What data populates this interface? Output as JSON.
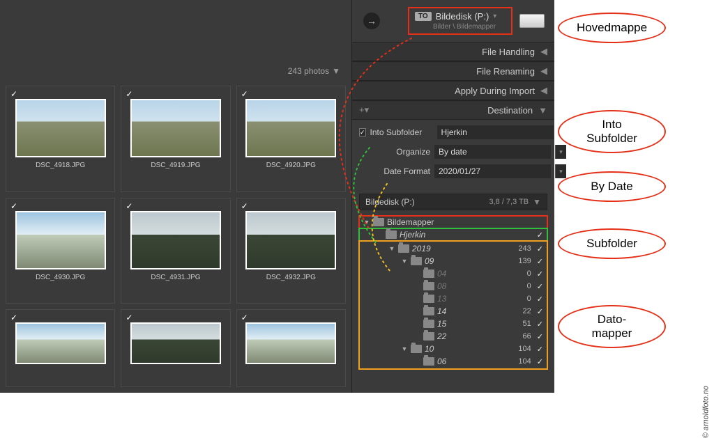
{
  "header": {
    "photo_count": "243 photos"
  },
  "thumbs": [
    {
      "file": "DSC_4918.JPG"
    },
    {
      "file": "DSC_4919.JPG"
    },
    {
      "file": "DSC_4920.JPG"
    },
    {
      "file": "DSC_4930.JPG"
    },
    {
      "file": "DSC_4931.JPG"
    },
    {
      "file": "DSC_4932.JPG"
    },
    {
      "file": ""
    },
    {
      "file": ""
    },
    {
      "file": ""
    }
  ],
  "destination": {
    "to_label": "TO",
    "drive": "Bildedisk (P:)",
    "path": "Bilder \\ Bildemapper",
    "sections": {
      "file_handling": "File Handling",
      "file_renaming": "File Renaming",
      "apply_during": "Apply During Import",
      "destination": "Destination"
    },
    "into_subfolder_label": "Into Subfolder",
    "subfolder": "Hjerkin",
    "organize_label": "Organize",
    "organize_value": "By date",
    "dateformat_label": "Date Format",
    "dateformat_value": "2020/01/27",
    "drive_usage": "3,8 / 7,3 TB",
    "drive_name": "Bildedisk (P:)"
  },
  "tree": [
    {
      "name": "Bildemapper",
      "indent": 0,
      "count": "",
      "hl": "red",
      "tri": "▼"
    },
    {
      "name": "Hjerkin",
      "indent": 1,
      "count": "",
      "hl": "green",
      "check": true,
      "ital": true,
      "tri": ""
    },
    {
      "name": "2019",
      "indent": 2,
      "count": "243",
      "check": true,
      "ital": true,
      "tri": "▼"
    },
    {
      "name": "09",
      "indent": 3,
      "count": "139",
      "check": true,
      "ital": true,
      "tri": "▼"
    },
    {
      "name": "04",
      "indent": 4,
      "count": "0",
      "check": true,
      "dim": true,
      "ital": true
    },
    {
      "name": "08",
      "indent": 4,
      "count": "0",
      "check": true,
      "dim": true,
      "ital": true
    },
    {
      "name": "13",
      "indent": 4,
      "count": "0",
      "check": true,
      "dim": true,
      "ital": true
    },
    {
      "name": "14",
      "indent": 4,
      "count": "22",
      "check": true,
      "ital": true
    },
    {
      "name": "15",
      "indent": 4,
      "count": "51",
      "check": true,
      "ital": true
    },
    {
      "name": "22",
      "indent": 4,
      "count": "66",
      "check": true,
      "ital": true
    },
    {
      "name": "10",
      "indent": 3,
      "count": "104",
      "check": true,
      "ital": true,
      "tri": "▼"
    },
    {
      "name": "06",
      "indent": 4,
      "count": "104",
      "check": true,
      "ital": true
    }
  ],
  "callouts": {
    "hovedmappe": "Hovedmappe",
    "into_subfolder": "Into\nSubfolder",
    "by_date": "By Date",
    "subfolder": "Subfolder",
    "datomapper": "Dato-\nmapper"
  },
  "credit": "© arnoldfoto.no"
}
